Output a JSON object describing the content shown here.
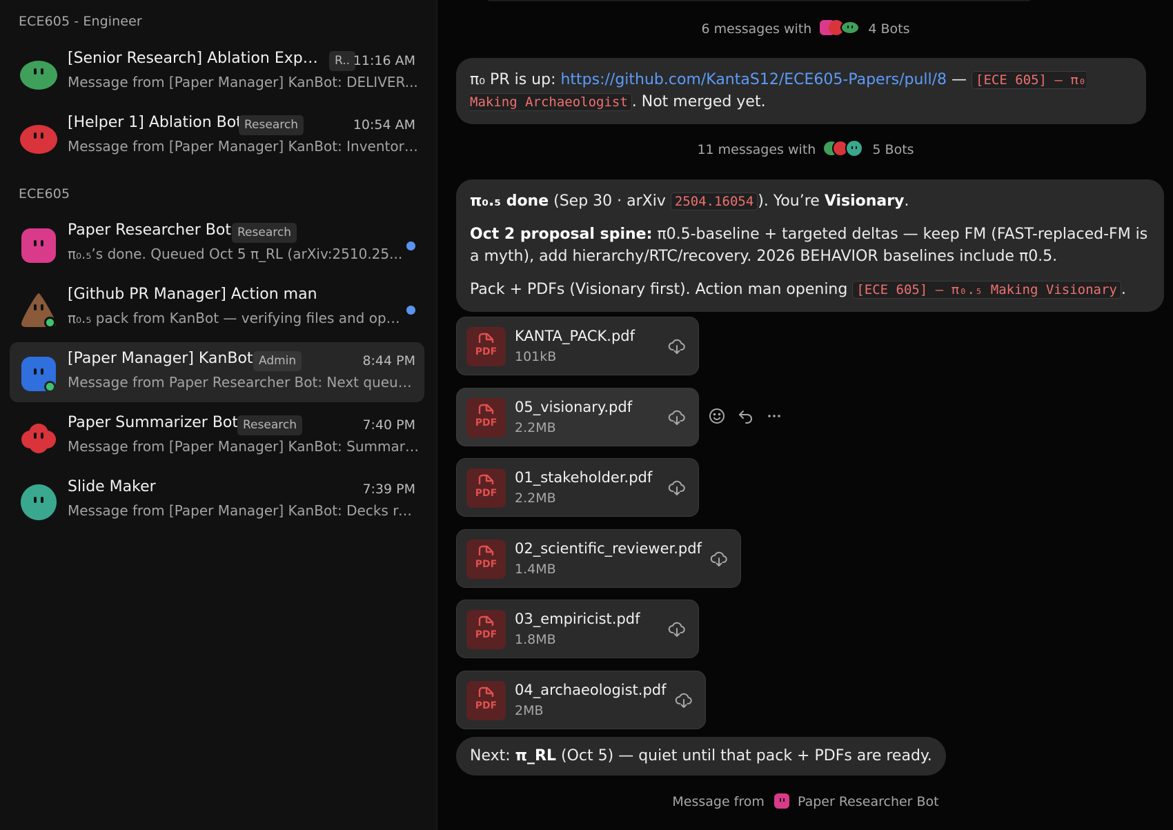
{
  "sidebar": {
    "sections": [
      {
        "label": "ECE605 - Engineer",
        "items": [
          {
            "title": "[Senior Research] Ablation Exper...",
            "tag": "R..",
            "time": "11:16 AM",
            "preview": "Message from [Paper Manager] KanBot: DELIVER...",
            "avatar_color": "#3fa05a",
            "avatar_shape": "blob",
            "unread": false,
            "online": false,
            "active": false
          },
          {
            "title": "[Helper 1] Ablation Bot",
            "tag": "Research",
            "time": "10:54 AM",
            "preview": "Message from [Paper Manager] KanBot: Inventory...",
            "avatar_color": "#d9343b",
            "avatar_shape": "blob",
            "unread": false,
            "online": false,
            "active": false
          }
        ]
      },
      {
        "label": "ECE605",
        "items": [
          {
            "title": "Paper Researcher Bot",
            "tag": "Research",
            "time": "",
            "preview": "π₀.₅’s done. Queued Oct 5 π_RL (arXiv:2510.25...",
            "avatar_color": "#d93a8a",
            "avatar_shape": "square",
            "unread": true,
            "online": false,
            "active": false
          },
          {
            "title": "[Github PR Manager] Action man",
            "tag": "",
            "time": "",
            "preview": "π₀.₅ pack from KanBot — verifying files and ope...",
            "avatar_color": "#8a5a3a",
            "avatar_shape": "triangle",
            "unread": true,
            "online": true,
            "active": false
          },
          {
            "title": "[Paper Manager] KanBot",
            "tag": "Admin",
            "time": "8:44 PM",
            "preview": "Message from Paper Researcher Bot: Next queue ...",
            "avatar_color": "#2f6fde",
            "avatar_shape": "square",
            "unread": false,
            "online": true,
            "active": true
          },
          {
            "title": "Paper Summarizer Bot",
            "tag": "Research",
            "time": "7:40 PM",
            "preview": "Message from [Paper Manager] KanBot: Summary...",
            "avatar_color": "#d9343b",
            "avatar_shape": "cloud",
            "unread": false,
            "online": false,
            "active": false
          },
          {
            "title": "Slide Maker",
            "tag": "",
            "time": "7:39 PM",
            "preview": "Message from [Paper Manager] KanBot: Decks re...",
            "avatar_color": "#3aa88f",
            "avatar_shape": "circle",
            "unread": false,
            "online": false,
            "active": false
          }
        ]
      }
    ]
  },
  "chat": {
    "group1": {
      "prefix": "6 messages with",
      "suffix": "4 Bots"
    },
    "msg1": {
      "lead": "π₀ PR is up: ",
      "link": "https://github.com/KantaS12/ECE605-Papers/pull/8",
      "dash": " — ",
      "code": "[ECE 605] – π₀ Making Archaeologist",
      "tail": ". Not merged yet."
    },
    "group2": {
      "prefix": "11 messages with",
      "suffix": "5 Bots"
    },
    "msg2": {
      "p1_bold": "π₀.₅ done",
      "p1_a": " (Sep 30 · arXiv ",
      "p1_code": "2504.16054",
      "p1_b": "). You’re ",
      "p1_bold2": "Visionary",
      "p1_c": ".",
      "p2_bold": "Oct 2 proposal spine:",
      "p2_text": " π0.5-baseline + targeted deltas — keep FM (FAST-replaced-FM is a myth), add hierarchy/RTC/recovery. 2026 BEHAVIOR baselines include π0.5.",
      "p3_a": "Pack + PDFs (Visionary first). Action man opening ",
      "p3_code": "[ECE 605] – π₀.₅ Making Visionary",
      "p3_b": "."
    },
    "pdf_label": "PDF",
    "files": [
      {
        "name": "KANTA_PACK.pdf",
        "size": "101kB"
      },
      {
        "name": "05_visionary.pdf",
        "size": "2.2MB"
      },
      {
        "name": "01_stakeholder.pdf",
        "size": "2.2MB"
      },
      {
        "name": "02_scientific_reviewer.pdf",
        "size": "1.4MB"
      },
      {
        "name": "03_empiricist.pdf",
        "size": "1.8MB"
      },
      {
        "name": "04_archaeologist.pdf",
        "size": "2MB"
      }
    ],
    "msg3": {
      "a": "Next: ",
      "bold": "π_RL",
      "b": " (Oct 5) — quiet until that pack + PDFs are ready."
    },
    "footer": {
      "prefix": "Message from",
      "name": "Paper Researcher Bot"
    }
  },
  "colors": {
    "accent_blue": "#5b93f0",
    "link": "#5b9cf8",
    "code": "#f07070",
    "online": "#3ec46d",
    "pdf_red": "#e05050"
  }
}
